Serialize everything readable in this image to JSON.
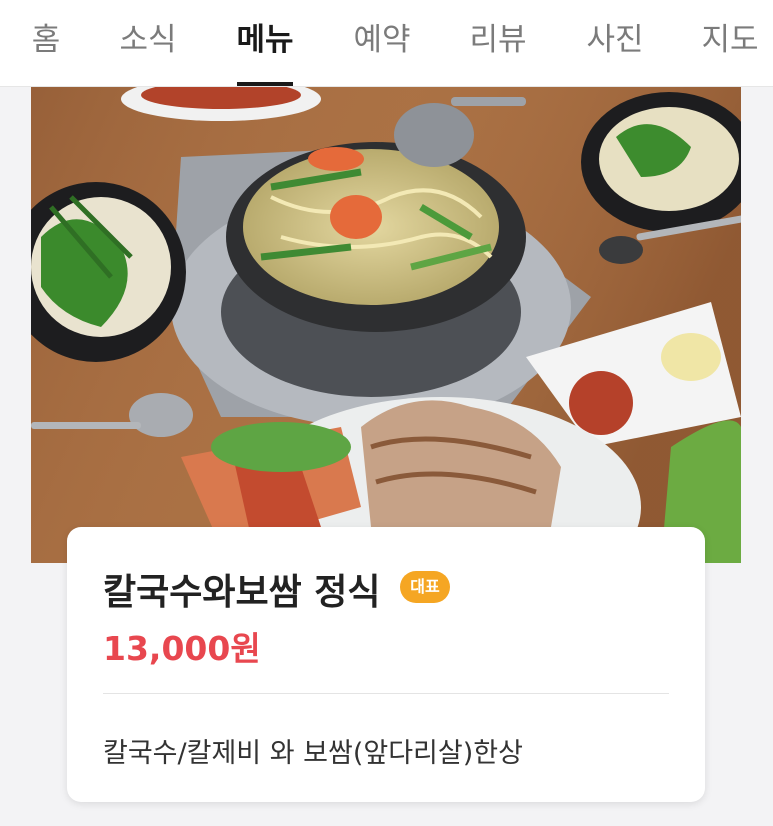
{
  "tabs": [
    {
      "label": "홈",
      "active": false
    },
    {
      "label": "소식",
      "active": false
    },
    {
      "label": "메뉴",
      "active": true
    },
    {
      "label": "예약",
      "active": false
    },
    {
      "label": "리뷰",
      "active": false
    },
    {
      "label": "사진",
      "active": false
    },
    {
      "label": "지도",
      "active": false
    }
  ],
  "menu_item": {
    "name": "칼국수와보쌈 정식",
    "badge": "대표",
    "price": "13,000원",
    "description": "칼국수/칼제비 와 보쌈(앞다리살)한상"
  },
  "colors": {
    "price": "#e8474f",
    "badge_bg": "#f5a623",
    "active_tab": "#1a1a1a",
    "inactive_tab": "#7b7b7b"
  }
}
